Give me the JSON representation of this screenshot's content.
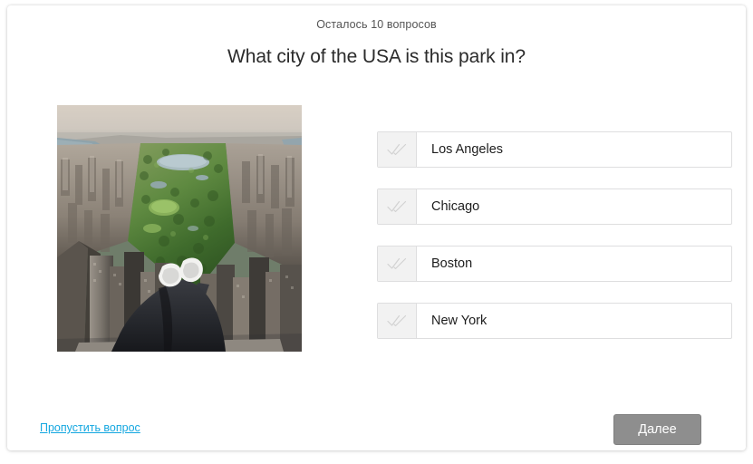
{
  "quiz": {
    "counter_text": "Осталось 10 вопросов",
    "question": "What city of the USA is this park in?",
    "image": {
      "alt": "Aerial view of Central Park in New York City with a person's legs dangling over the edge of a skyscraper",
      "icon_name": "central-park-aerial-photo"
    },
    "options": [
      {
        "label": "Los Angeles",
        "icon": "double-check-icon"
      },
      {
        "label": "Chicago",
        "icon": "double-check-icon"
      },
      {
        "label": "Boston",
        "icon": "double-check-icon"
      },
      {
        "label": "New York",
        "icon": "double-check-icon"
      }
    ],
    "skip_link": "Пропустить вопрос",
    "next_button": "Далее"
  },
  "colors": {
    "link": "#14a7e0",
    "button_bg": "#8e8e8e",
    "icon_cell_bg": "#f2f2f2",
    "border": "#dededf"
  }
}
